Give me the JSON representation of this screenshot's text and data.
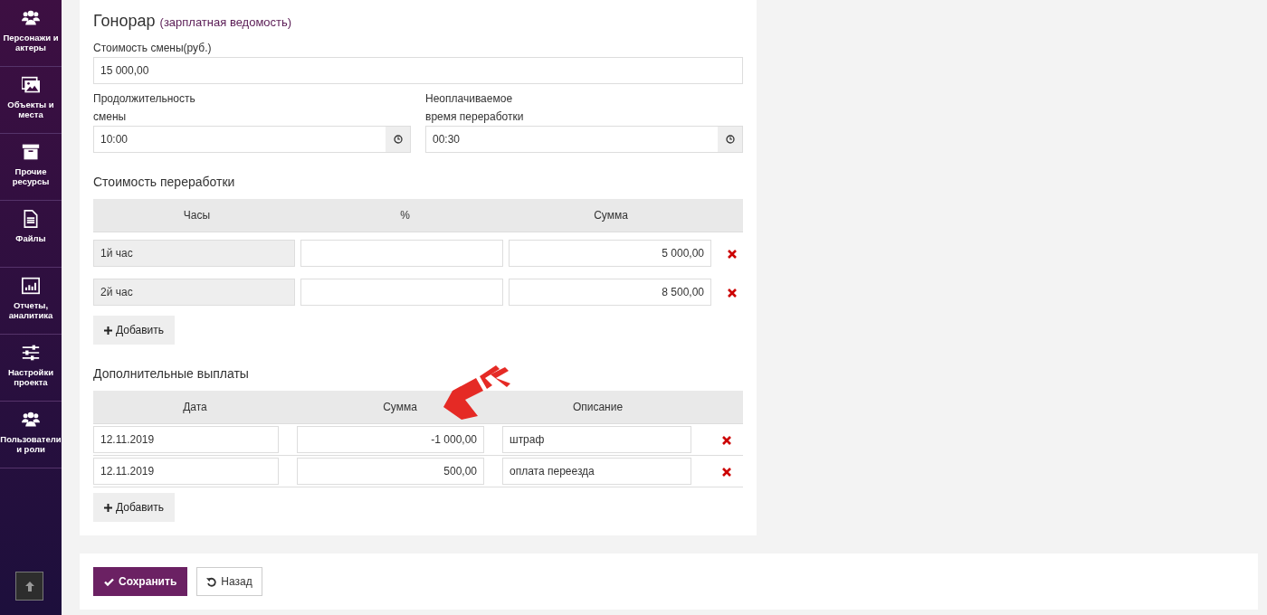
{
  "sidebar": {
    "items": [
      {
        "label": "Персонажи и актеры",
        "kind": "users"
      },
      {
        "label": "Объекты и места",
        "kind": "images"
      },
      {
        "label": "Прочие ресурсы",
        "kind": "archive"
      },
      {
        "label": "Файлы",
        "kind": "file"
      },
      {
        "label": "Отчеты, аналитика",
        "kind": "chart"
      },
      {
        "label": "Настройки проекта",
        "kind": "sliders"
      },
      {
        "label": "Пользователи и роли",
        "kind": "users"
      }
    ]
  },
  "fee": {
    "title": "Гонорар",
    "subtitle": "(зарплатная ведомость)",
    "shift_cost": {
      "label": "Стоимость смены(руб.)",
      "value": "15 000,00"
    },
    "time_fields": [
      {
        "label": "Продолжительность\nсмены",
        "value": "10:00"
      },
      {
        "label": "Неоплачиваемое\nвремя переработки",
        "value": "00:30"
      }
    ],
    "overtime": {
      "title": "Стоимость переработки",
      "columns": [
        "Часы",
        "%",
        "Сумма"
      ],
      "rows": [
        {
          "hours": "1й час",
          "sum": "5 000,00"
        },
        {
          "hours": "2й час",
          "sum": "8 500,00"
        }
      ],
      "add_button": "Добавить"
    },
    "extra": {
      "title": "Дополнительные выплаты",
      "columns": [
        "Дата",
        "Сумма",
        "Описание"
      ],
      "rows": [
        {
          "date": "12.11.2019",
          "sum": "-1 000,00",
          "description": "штраф"
        },
        {
          "date": "12.11.2019",
          "sum": "500,00",
          "description": "оплата переезда"
        }
      ],
      "add_button": "Добавить"
    }
  },
  "footer": {
    "buttons": [
      {
        "kind": "save",
        "label": "Сохранить"
      },
      {
        "kind": "back",
        "label": "Назад"
      }
    ]
  }
}
